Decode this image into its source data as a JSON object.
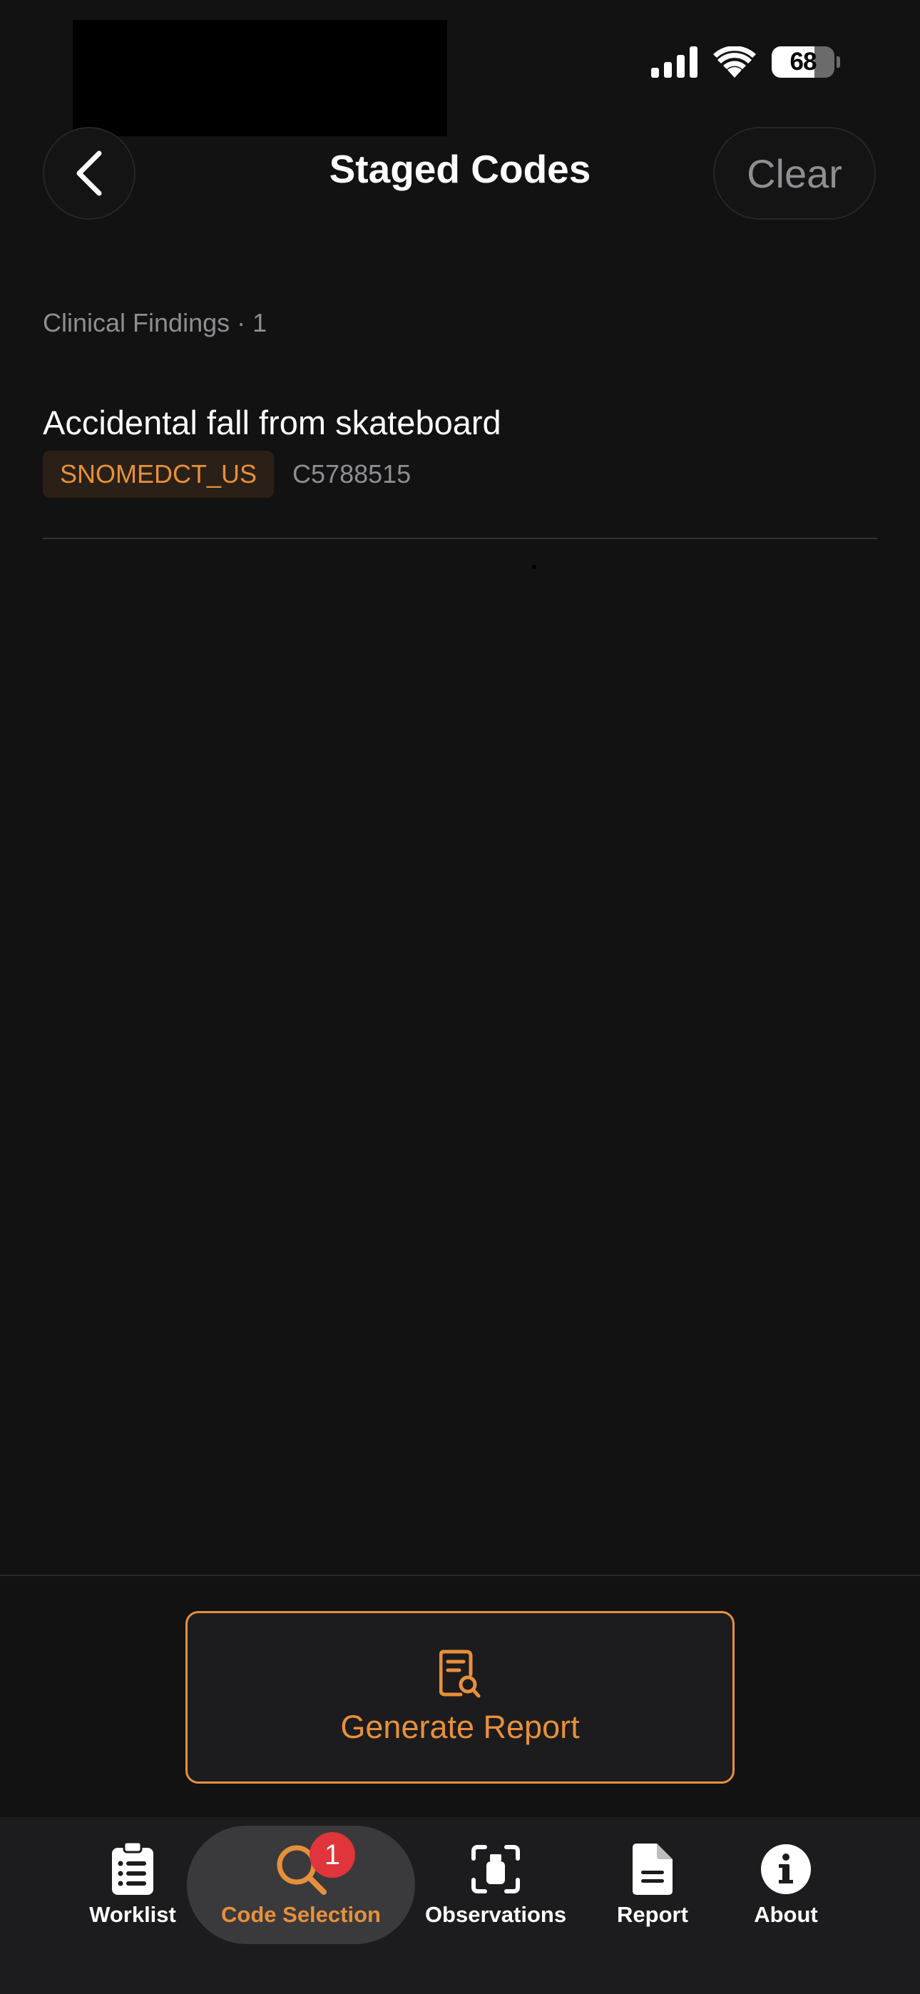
{
  "status_bar": {
    "battery_level": "68",
    "battery_fraction": 0.68
  },
  "nav": {
    "back_icon": "chevron-left-icon",
    "title": "Staged Codes",
    "clear_label": "Clear"
  },
  "section": {
    "header": "Clinical Findings · 1"
  },
  "codes": [
    {
      "title": "Accidental fall from skateboard",
      "system": "SNOMEDCT_US",
      "code": "C5788515"
    }
  ],
  "footer": {
    "generate_icon": "document-search-icon",
    "generate_label": "Generate Report"
  },
  "tabs": [
    {
      "label": "Worklist",
      "icon": "clipboard-list-icon",
      "active": false
    },
    {
      "label": "Code Selection",
      "icon": "magnifier-icon",
      "active": true,
      "badge": "1"
    },
    {
      "label": "Observations",
      "icon": "scan-icon",
      "active": false
    },
    {
      "label": "Report",
      "icon": "document-icon",
      "active": false
    },
    {
      "label": "About",
      "icon": "info-icon",
      "active": false
    }
  ],
  "colors": {
    "accent": "#e7903b",
    "background": "#121212",
    "badge": "#e0353a",
    "secondary_text": "#8e8e93"
  }
}
